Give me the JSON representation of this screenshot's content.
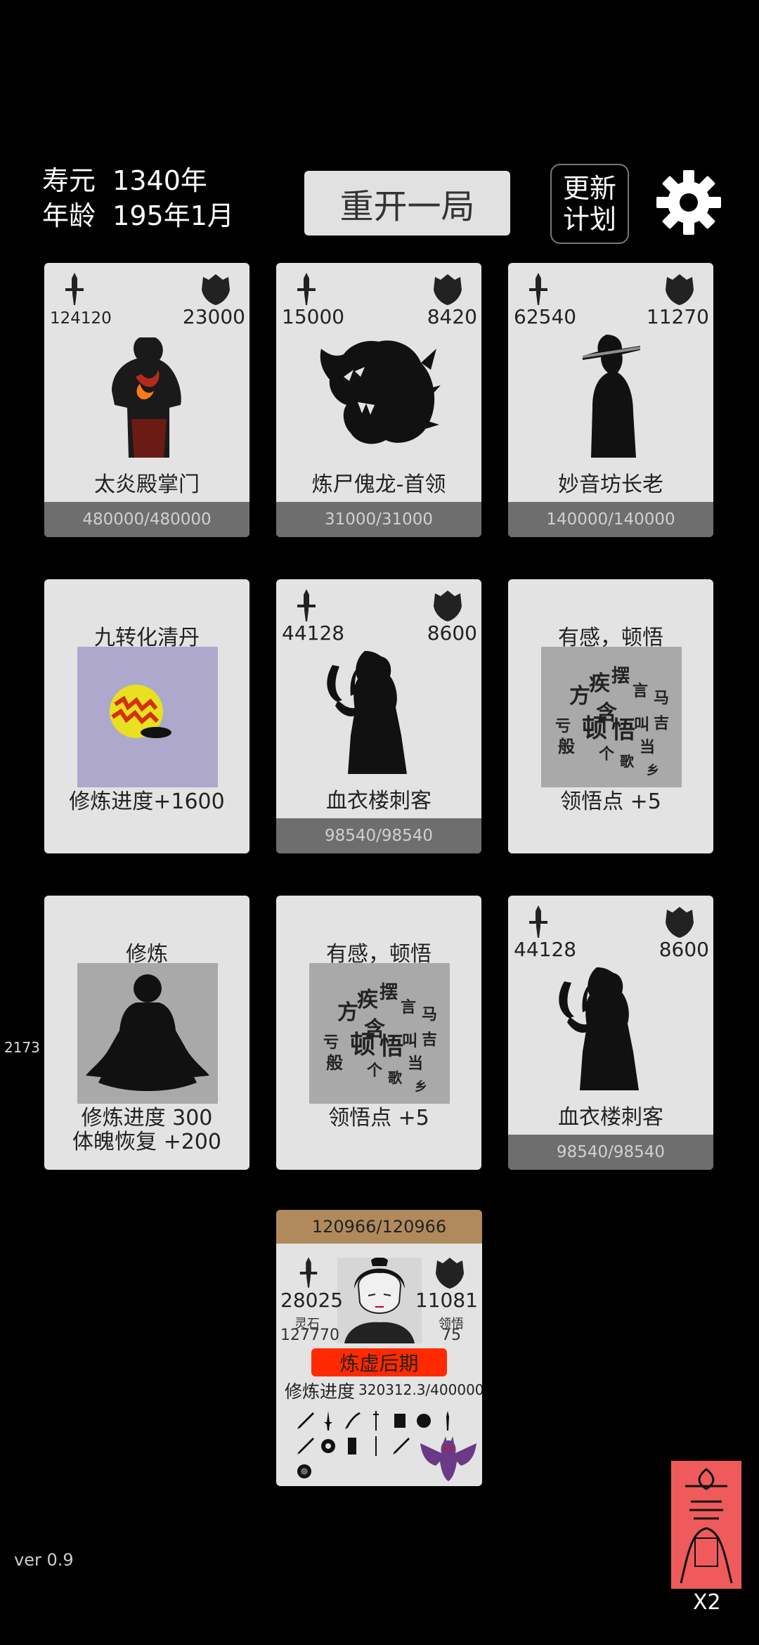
{
  "header": {
    "lifespan": "寿元  1340年",
    "age": "年龄  195年1月",
    "restart_label": "重开一局",
    "update_label_line1": "更新",
    "update_label_line2": "计划",
    "settings_icon": "gear-icon"
  },
  "cards": {
    "c1": {
      "atk": "124120",
      "def": "23000",
      "name": "太炎殿掌门",
      "hp": "480000/480000"
    },
    "c2": {
      "atk": "15000",
      "def": "8420",
      "name": "炼尸傀龙-首领",
      "hp": "31000/31000"
    },
    "c3": {
      "atk": "62540",
      "def": "11270",
      "name": "妙音坊长老",
      "hp": "140000/140000"
    },
    "c4": {
      "title": "九转化清丹",
      "desc": "修炼进度+1600"
    },
    "c5": {
      "atk": "44128",
      "def": "8600",
      "name": "血衣楼刺客",
      "hp": "98540/98540"
    },
    "c6": {
      "title": "有感，顿悟",
      "desc": "领悟点  +5"
    },
    "c7": {
      "title": "修炼",
      "desc1": "修炼进度  300",
      "desc2": "体魄恢复  +200"
    },
    "c8": {
      "title": "有感，顿悟",
      "desc": "领悟点  +5"
    },
    "c9": {
      "atk": "44128",
      "def": "8600",
      "name": "血衣楼刺客",
      "hp": "98540/98540"
    }
  },
  "player": {
    "hp": "120966/120966",
    "atk": "28025",
    "def": "11081",
    "spirit_stone_label": "灵石",
    "spirit_stone": "127770",
    "insight_label": "领悟",
    "insight": "75",
    "realm": "炼虚后期",
    "progress_label": "修炼进度",
    "progress_value": "320312.3/400000"
  },
  "side_number": "2173",
  "version": "ver 0.9",
  "talisman_multiplier": "X2",
  "colors": {
    "background": "#000000",
    "card": "#e3e3e3",
    "hp_bar": "#6e6e6e",
    "player_hp_bar": "#b08a5c",
    "realm_badge": "#ff2a00",
    "talisman": "#ef5b5b"
  }
}
